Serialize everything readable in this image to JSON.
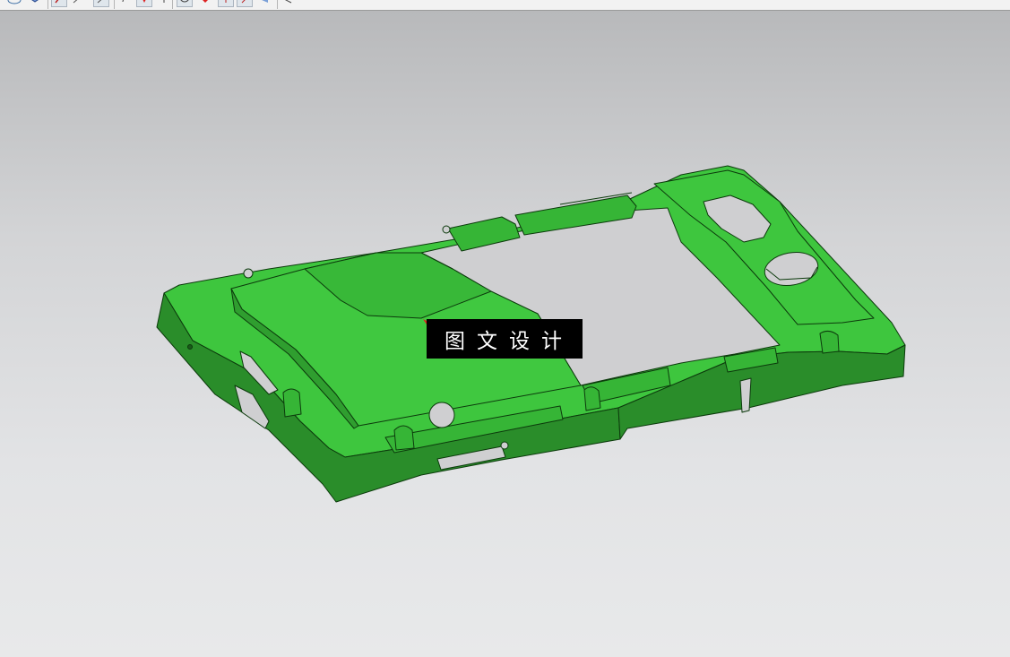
{
  "toolbar": {
    "icons": [
      "orient-view-icon",
      "shaded-cube-icon",
      "snap-point-icon",
      "line-tool-icon",
      "arc-tool-icon",
      "undo-icon",
      "filter-icon",
      "rotate-icon",
      "selection-icon",
      "dim-icon",
      "arrow-icon",
      "triangle-left-icon"
    ]
  },
  "watermark": {
    "text": "图文设计"
  },
  "colors": {
    "part_green": "#3ec63e",
    "part_dark": "#2a8d2a",
    "edge": "#0c3a0c",
    "background_top": "#b8b9bb",
    "background_bottom": "#e8e9ea"
  }
}
